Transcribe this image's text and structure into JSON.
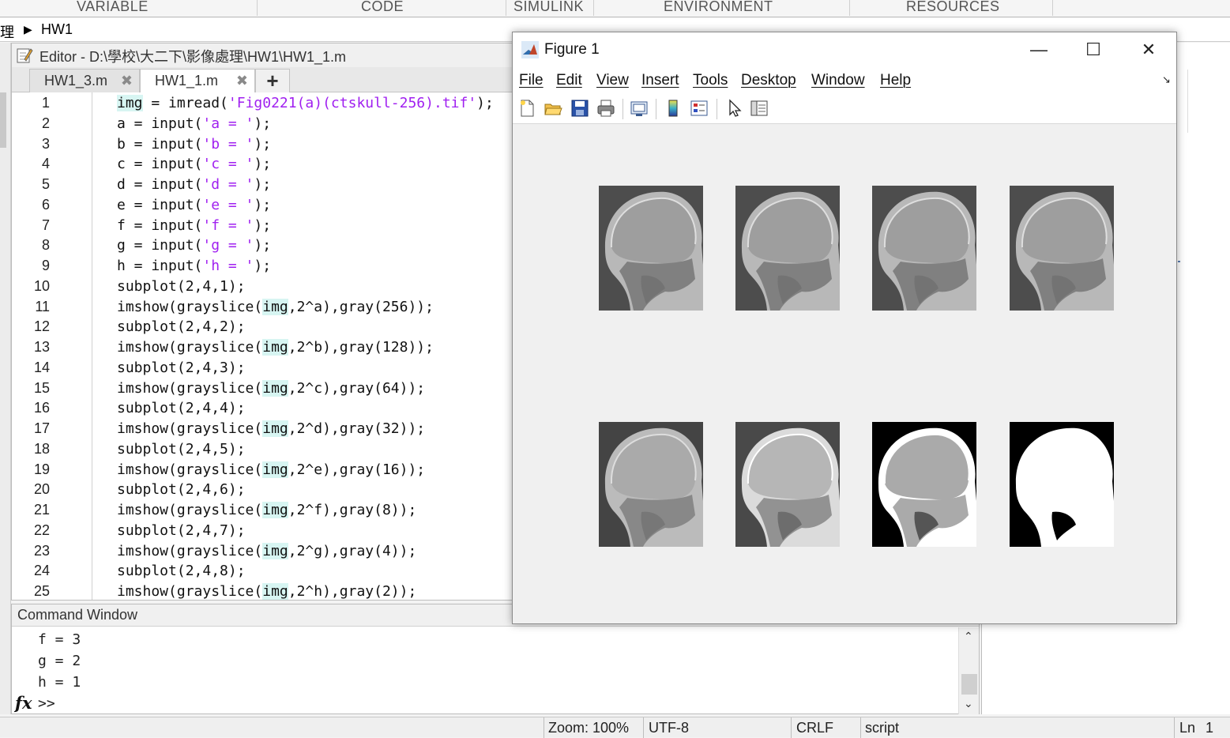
{
  "ribbon": {
    "tabs": [
      "VARIABLE",
      "CODE",
      "SIMULINK",
      "ENVIRONMENT",
      "RESOURCES"
    ]
  },
  "breadcrumb": {
    "partial": "理",
    "current": "HW1"
  },
  "editor": {
    "title": "Editor - D:\\學校\\大二下\\影像處理\\HW1\\HW1_1.m",
    "tabs": [
      {
        "label": "HW1_3.m"
      },
      {
        "label": "HW1_1.m"
      }
    ],
    "add_tab": "+",
    "lines": [
      {
        "n": "1",
        "pre": "",
        "hl": "img",
        "post": " = imread(",
        "str": "'Fig0221(a)(ctskull-256).tif'",
        "end": ");"
      },
      {
        "n": "2",
        "pre": "a = input(",
        "hl": "",
        "post": "",
        "str": "'a = '",
        "end": ");"
      },
      {
        "n": "3",
        "pre": "b = input(",
        "hl": "",
        "post": "",
        "str": "'b = '",
        "end": ");"
      },
      {
        "n": "4",
        "pre": "c = input(",
        "hl": "",
        "post": "",
        "str": "'c = '",
        "end": ");"
      },
      {
        "n": "5",
        "pre": "d = input(",
        "hl": "",
        "post": "",
        "str": "'d = '",
        "end": ");"
      },
      {
        "n": "6",
        "pre": "e = input(",
        "hl": "",
        "post": "",
        "str": "'e = '",
        "end": ");"
      },
      {
        "n": "7",
        "pre": "f = input(",
        "hl": "",
        "post": "",
        "str": "'f = '",
        "end": ");"
      },
      {
        "n": "8",
        "pre": "g = input(",
        "hl": "",
        "post": "",
        "str": "'g = '",
        "end": ");"
      },
      {
        "n": "9",
        "pre": "h = input(",
        "hl": "",
        "post": "",
        "str": "'h = '",
        "end": ");"
      },
      {
        "n": "10",
        "pre": "subplot(2,4,1);",
        "hl": "",
        "post": "",
        "str": "",
        "end": ""
      },
      {
        "n": "11",
        "pre": "imshow(grayslice(",
        "hl": "img",
        "post": ",2^a),gray(256));",
        "str": "",
        "end": ""
      },
      {
        "n": "12",
        "pre": "subplot(2,4,2);",
        "hl": "",
        "post": "",
        "str": "",
        "end": ""
      },
      {
        "n": "13",
        "pre": "imshow(grayslice(",
        "hl": "img",
        "post": ",2^b),gray(128));",
        "str": "",
        "end": ""
      },
      {
        "n": "14",
        "pre": "subplot(2,4,3);",
        "hl": "",
        "post": "",
        "str": "",
        "end": ""
      },
      {
        "n": "15",
        "pre": "imshow(grayslice(",
        "hl": "img",
        "post": ",2^c),gray(64));",
        "str": "",
        "end": ""
      },
      {
        "n": "16",
        "pre": "subplot(2,4,4);",
        "hl": "",
        "post": "",
        "str": "",
        "end": ""
      },
      {
        "n": "17",
        "pre": "imshow(grayslice(",
        "hl": "img",
        "post": ",2^d),gray(32));",
        "str": "",
        "end": ""
      },
      {
        "n": "18",
        "pre": "subplot(2,4,5);",
        "hl": "",
        "post": "",
        "str": "",
        "end": ""
      },
      {
        "n": "19",
        "pre": "imshow(grayslice(",
        "hl": "img",
        "post": ",2^e),gray(16));",
        "str": "",
        "end": ""
      },
      {
        "n": "20",
        "pre": "subplot(2,4,6);",
        "hl": "",
        "post": "",
        "str": "",
        "end": ""
      },
      {
        "n": "21",
        "pre": "imshow(grayslice(",
        "hl": "img",
        "post": ",2^f),gray(8));",
        "str": "",
        "end": ""
      },
      {
        "n": "22",
        "pre": "subplot(2,4,7);",
        "hl": "",
        "post": "",
        "str": "",
        "end": ""
      },
      {
        "n": "23",
        "pre": "imshow(grayslice(",
        "hl": "img",
        "post": ",2^g),gray(4));",
        "str": "",
        "end": ""
      },
      {
        "n": "24",
        "pre": "subplot(2,4,8);",
        "hl": "",
        "post": "",
        "str": "",
        "end": ""
      },
      {
        "n": "25",
        "pre": "imshow(grayslice(",
        "hl": "img",
        "post": ",2^h),gray(2));",
        "str": "",
        "end": ""
      }
    ]
  },
  "command_window": {
    "title": "Command Window",
    "lines": [
      "f = 3",
      "g = 2",
      "h = 1"
    ],
    "fx": "fx",
    "prompt": ">>"
  },
  "figure": {
    "title": "Figure 1",
    "menu": [
      "File",
      "Edit",
      "View",
      "Insert",
      "Tools",
      "Desktop",
      "Window",
      "Help"
    ],
    "toolbar_icons": [
      "new-figure-icon",
      "open-file-icon",
      "save-icon",
      "print-icon",
      "link-plot-icon",
      "colorbar-icon",
      "legend-icon",
      "pointer-icon",
      "property-inspector-icon"
    ],
    "subplots": [
      {
        "levels": 256
      },
      {
        "levels": 128
      },
      {
        "levels": 64
      },
      {
        "levels": 32
      },
      {
        "levels": 16
      },
      {
        "levels": 8
      },
      {
        "levels": 4
      },
      {
        "levels": 2
      }
    ]
  },
  "status_bar": {
    "zoom": "Zoom: 100%",
    "encoding": "UTF-8",
    "line_ending": "CRLF",
    "type": "script",
    "ln_label": "Ln",
    "ln_value": "1"
  },
  "colors": {
    "string": "#a020f0",
    "highlight": "#d7f5f2"
  }
}
